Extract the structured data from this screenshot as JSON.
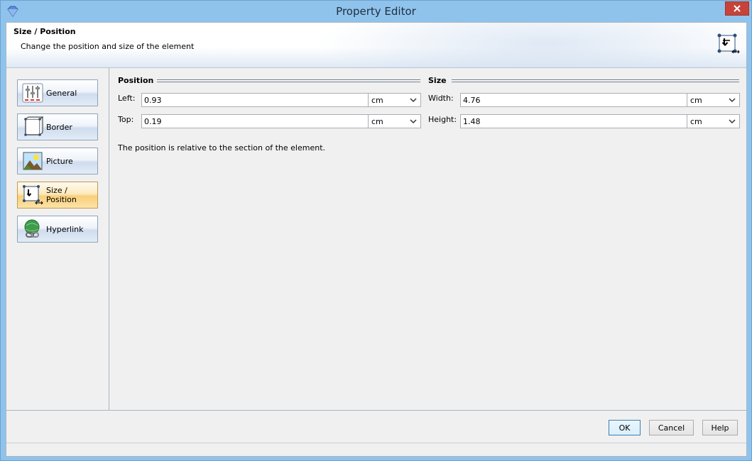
{
  "window": {
    "title": "Property Editor"
  },
  "header": {
    "title": "Size / Position",
    "subtitle": "Change the position and size of the element"
  },
  "sidebar": {
    "items": [
      {
        "label": "General",
        "icon": "sliders-icon"
      },
      {
        "label": "Border",
        "icon": "border-frame-icon"
      },
      {
        "label": "Picture",
        "icon": "picture-icon"
      },
      {
        "label": "Size / Position",
        "icon": "move-resize-icon",
        "active": true
      },
      {
        "label": "Hyperlink",
        "icon": "globe-link-icon"
      }
    ]
  },
  "position": {
    "title": "Position",
    "left": {
      "label": "Left:",
      "value": "0.93",
      "unit": "cm"
    },
    "top": {
      "label": "Top:",
      "value": "0.19",
      "unit": "cm"
    }
  },
  "size": {
    "title": "Size",
    "width": {
      "label": "Width:",
      "value": "4.76",
      "unit": "cm"
    },
    "height": {
      "label": "Height:",
      "value": "1.48",
      "unit": "cm"
    }
  },
  "note": "The position is relative to the section of the element.",
  "buttons": {
    "ok": "OK",
    "cancel": "Cancel",
    "help": "Help"
  },
  "colors": {
    "active_tab": "#f9cf7a",
    "close_button": "#c7433a",
    "window_frame": "#8fc3ec"
  }
}
